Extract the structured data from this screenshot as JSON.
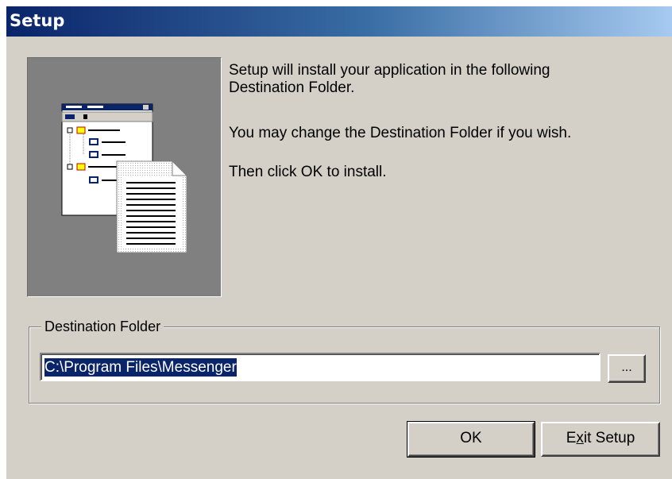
{
  "window": {
    "title": "Setup"
  },
  "message": {
    "line1": "Setup will install your application in the following",
    "line2": "Destination Folder.",
    "line3": "You may change the Destination Folder if you wish.",
    "line4": "Then click OK to install."
  },
  "destination": {
    "legend": "Destination Folder",
    "value": "C:\\Program Files\\Messenger",
    "browse_label": "..."
  },
  "buttons": {
    "ok_label": "OK",
    "exit_pre": "E",
    "exit_accel": "x",
    "exit_post": "it Setup"
  },
  "colors": {
    "titlebar_start": "#0a246a",
    "titlebar_end": "#a6caf0",
    "dialog_bg": "#d4d0c8",
    "selection": "#0a246a"
  }
}
